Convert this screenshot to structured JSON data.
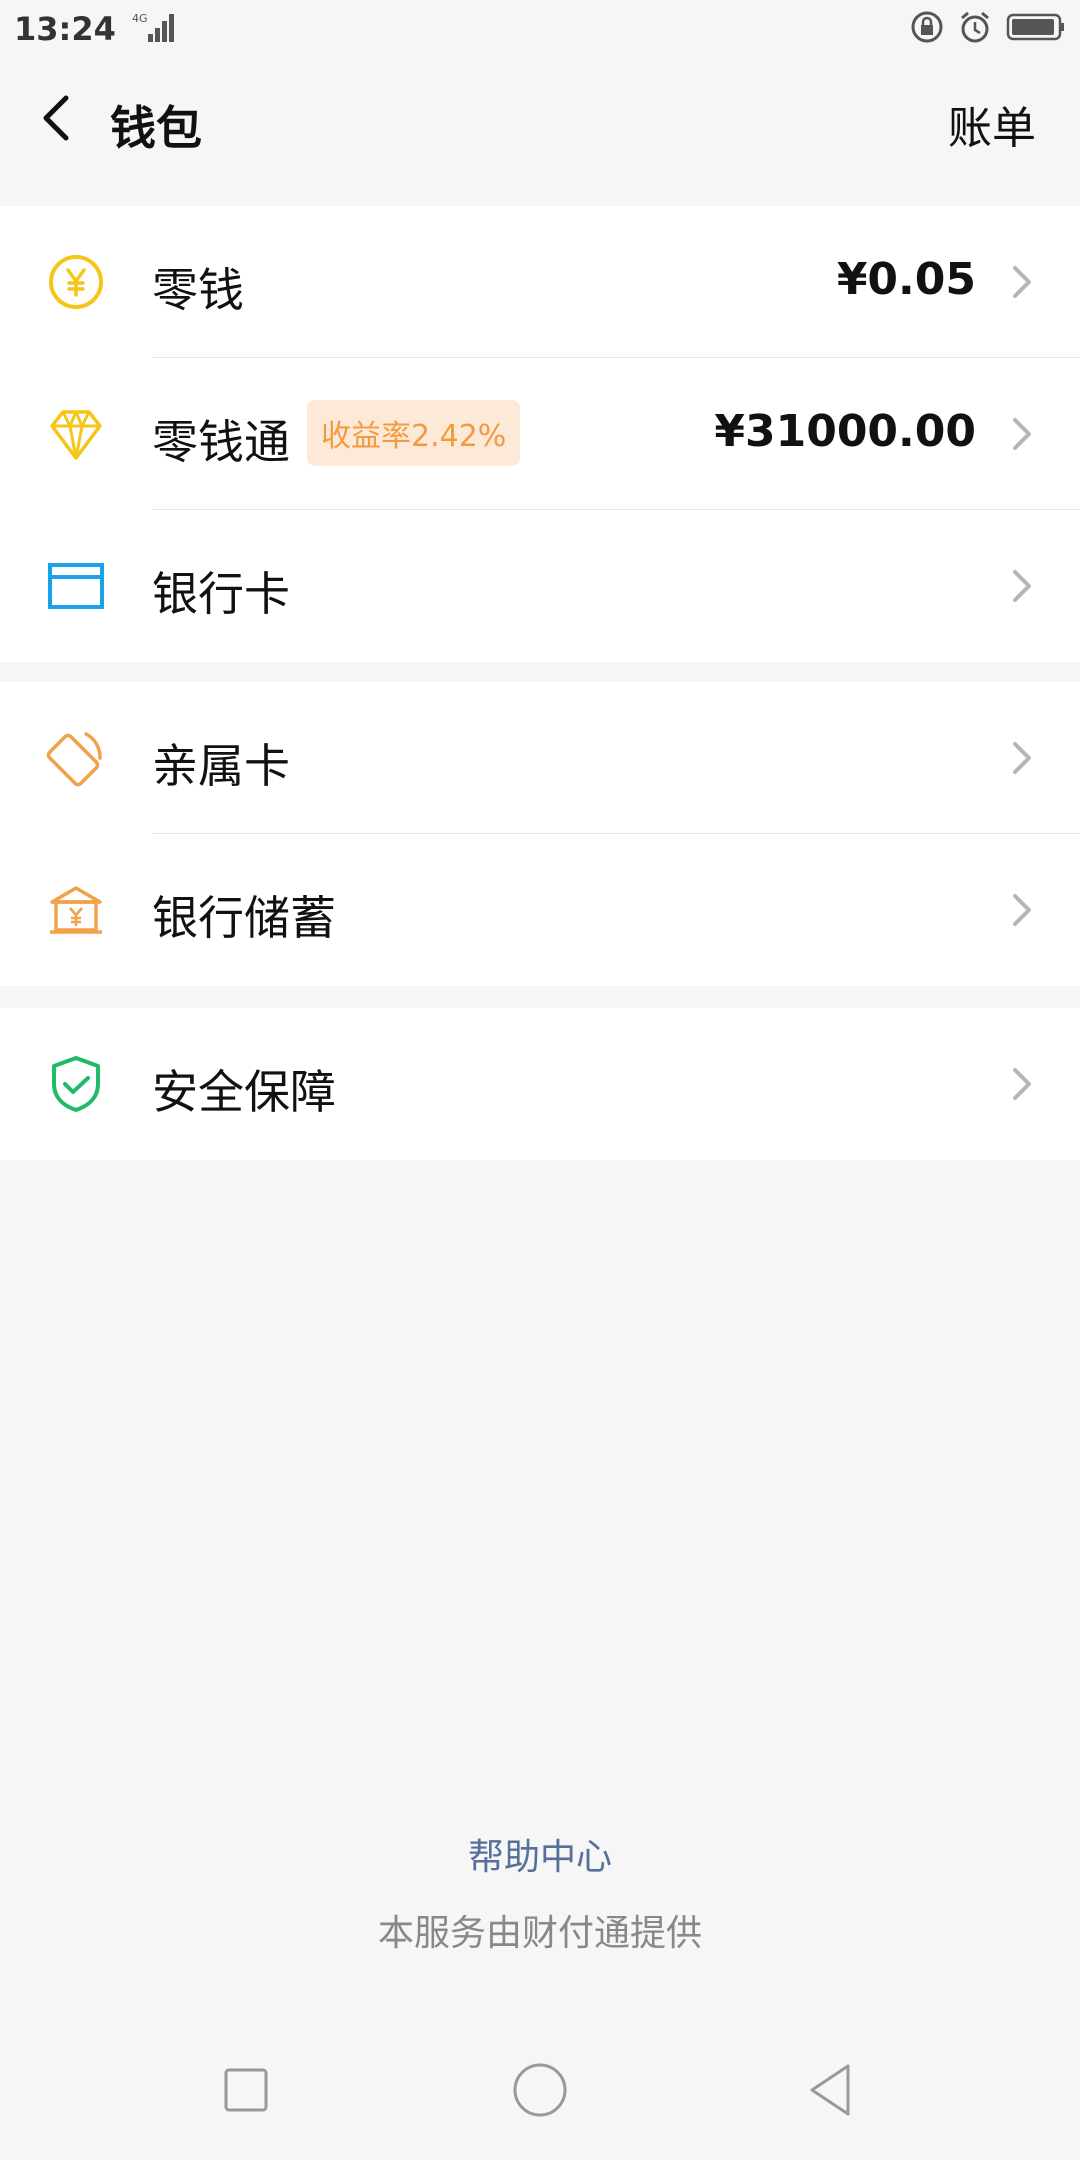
{
  "status_bar": {
    "time": "13:24",
    "network": "4G",
    "icons": [
      "signal-icon",
      "lock-rotation-icon",
      "alarm-icon",
      "battery-icon"
    ]
  },
  "header": {
    "title": "钱包",
    "bill_label": "账单",
    "back_icon": "chevron-left-icon"
  },
  "groups": [
    {
      "rows": [
        {
          "label": "零钱",
          "value": "¥0.05",
          "icon": "yen-coin-icon"
        },
        {
          "label": "零钱通",
          "badge": "收益率2.42%",
          "value": "¥31000.00",
          "icon": "diamond-icon"
        },
        {
          "label": "银行卡",
          "icon": "bank-card-icon"
        }
      ]
    },
    {
      "rows": [
        {
          "label": "亲属卡",
          "icon": "family-card-icon"
        },
        {
          "label": "银行储蓄",
          "icon": "bank-savings-icon"
        }
      ]
    },
    {
      "rows": [
        {
          "label": "安全保障",
          "icon": "shield-check-icon"
        }
      ]
    }
  ],
  "footer": {
    "help_label": "帮助中心",
    "provider_text": "本服务由财付通提供"
  },
  "colors": {
    "background": "#f6f6f6",
    "coin_yellow": "#f5c518",
    "card_blue": "#1aa3e8",
    "family_orange": "#f0a14a",
    "shield_green": "#1fba6a",
    "badge_bg": "#fde9d8",
    "badge_text": "#f29b3f",
    "link_blue": "#56709a"
  }
}
